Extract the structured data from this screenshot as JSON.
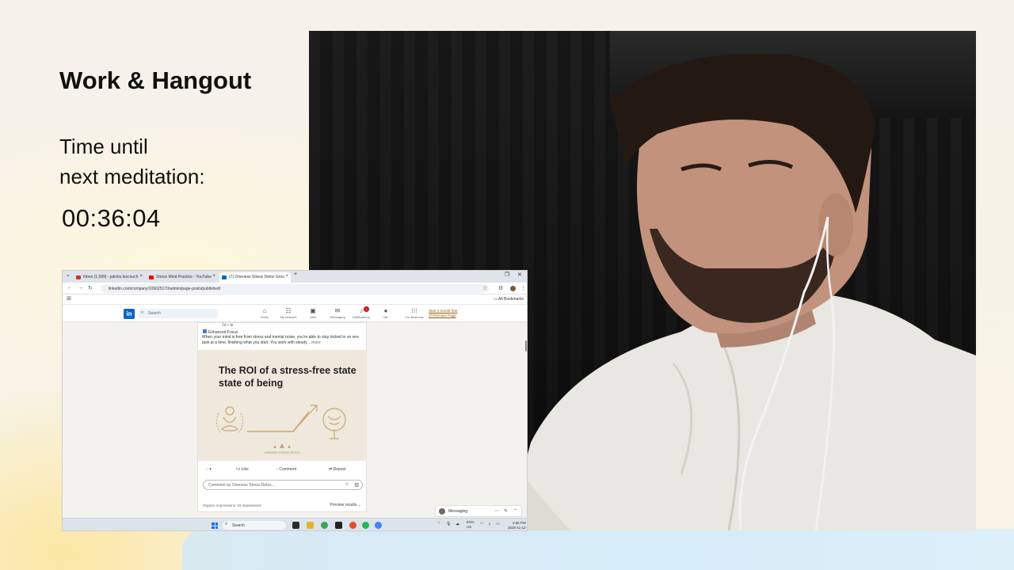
{
  "slide": {
    "title": "Work & Hangout",
    "timer_label_line1": "Time until",
    "timer_label_line2": "next meditation:",
    "timer_value": "00:36:04"
  },
  "colors": {
    "background": "#f7f4ec",
    "bottom_band": "#d6ecf8",
    "linkedin_blue": "#0a66c2"
  },
  "browser": {
    "tabs": [
      {
        "label": "Inbox (1,599) - jakobs.lescouch",
        "icon": "gmail-icon"
      },
      {
        "label": "Stress Mind Practice - YouTube",
        "icon": "youtube-icon"
      },
      {
        "label": "(7) Oneness Stress Detox Grou",
        "icon": "linkedin-icon"
      }
    ],
    "new_tab": "+",
    "url": "linkedin.com/company/109025170/admin/page-posts/published/",
    "all_bookmarks": "All Bookmarks"
  },
  "linkedin": {
    "logo": "in",
    "search_placeholder": "Search",
    "nav": [
      {
        "label": "Home",
        "icon": "home-icon"
      },
      {
        "label": "My Network",
        "icon": "network-icon"
      },
      {
        "label": "Jobs",
        "icon": "briefcase-icon"
      },
      {
        "label": "Messaging",
        "icon": "chat-icon"
      },
      {
        "label": "Notifications",
        "icon": "bell-icon",
        "badge": "1"
      },
      {
        "label": "Me",
        "icon": "avatar-icon"
      },
      {
        "label": "For Business",
        "icon": "grid-icon"
      }
    ],
    "premium_line1": "Start 1-month free",
    "premium_line2": "of Premium Page"
  },
  "post": {
    "meta": "1d • ⊕",
    "author": "Enhanced Focus",
    "text": "When your mind is free from stress and mental noise, you're able to stay locked in on one task at a time, finishing what you start. You work with steady",
    "more": "...more",
    "image_title": "The ROI of a stress-free state state of being",
    "image_caption": "ONENESS STRESS DETOX",
    "actions": [
      "Like",
      "Comment",
      "Repost"
    ],
    "comment_placeholder": "Comment as Oneness Stress Detox...",
    "impressions": "Organic impressions: 15 impressions",
    "preview_results": "Preview results"
  },
  "messaging": {
    "label": "Messaging"
  },
  "taskbar": {
    "search": "Search",
    "tray_lang_line1": "ENG",
    "tray_lang_line2": "US",
    "time": "4:56 PM",
    "date": "2025-11-12"
  }
}
